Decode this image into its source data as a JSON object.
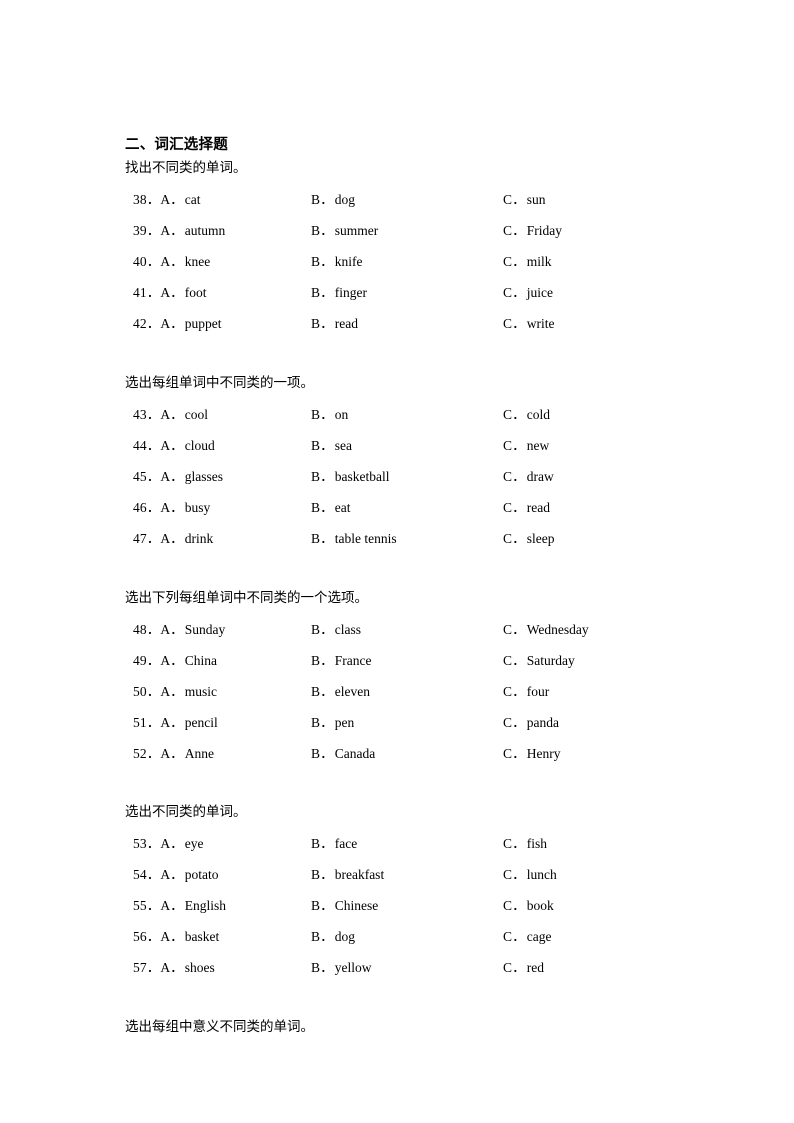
{
  "document": {
    "heading": "二、词汇选择题",
    "sections": [
      {
        "instruction": "找出不同类的单词。",
        "questions": [
          {
            "number": "38．",
            "a_label": "A．",
            "a": "cat",
            "b_label": "B．",
            "b": "dog",
            "c_label": "C．",
            "c": "sun"
          },
          {
            "number": "39．",
            "a_label": "A．",
            "a": "autumn",
            "b_label": "B．",
            "b": "summer",
            "c_label": "C．",
            "c": "Friday"
          },
          {
            "number": "40．",
            "a_label": "A．",
            "a": "knee",
            "b_label": "B．",
            "b": "knife",
            "c_label": "C．",
            "c": "milk"
          },
          {
            "number": "41．",
            "a_label": "A．",
            "a": "foot",
            "b_label": "B．",
            "b": "finger",
            "c_label": "C．",
            "c": "juice"
          },
          {
            "number": "42．",
            "a_label": "A．",
            "a": "puppet",
            "b_label": "B．",
            "b": "read",
            "c_label": "C．",
            "c": "write"
          }
        ]
      },
      {
        "instruction": "选出每组单词中不同类的一项。",
        "questions": [
          {
            "number": "43．",
            "a_label": "A．",
            "a": "cool",
            "b_label": "B．",
            "b": "on",
            "c_label": "C．",
            "c": "cold"
          },
          {
            "number": "44．",
            "a_label": "A．",
            "a": "cloud",
            "b_label": "B．",
            "b": "sea",
            "c_label": "C．",
            "c": "new"
          },
          {
            "number": "45．",
            "a_label": "A．",
            "a": "glasses",
            "b_label": "B．",
            "b": "basketball",
            "c_label": "C．",
            "c": "draw"
          },
          {
            "number": "46．",
            "a_label": "A．",
            "a": "busy",
            "b_label": "B．",
            "b": "eat",
            "c_label": "C．",
            "c": "read"
          },
          {
            "number": "47．",
            "a_label": "A．",
            "a": "drink",
            "b_label": "B．",
            "b": "table tennis",
            "c_label": "C．",
            "c": "sleep"
          }
        ]
      },
      {
        "instruction": "选出下列每组单词中不同类的一个选项。",
        "questions": [
          {
            "number": "48．",
            "a_label": "A．",
            "a": "Sunday",
            "b_label": "B．",
            "b": "class",
            "c_label": "C．",
            "c": "Wednesday"
          },
          {
            "number": "49．",
            "a_label": "A．",
            "a": "China",
            "b_label": "B．",
            "b": "France",
            "c_label": "C．",
            "c": "Saturday"
          },
          {
            "number": "50．",
            "a_label": "A．",
            "a": "music",
            "b_label": "B．",
            "b": "eleven",
            "c_label": "C．",
            "c": "four"
          },
          {
            "number": "51．",
            "a_label": "A．",
            "a": "pencil",
            "b_label": "B．",
            "b": "pen",
            "c_label": "C．",
            "c": "panda"
          },
          {
            "number": "52．",
            "a_label": "A．",
            "a": "Anne",
            "b_label": "B．",
            "b": "Canada",
            "c_label": "C．",
            "c": "Henry"
          }
        ]
      },
      {
        "instruction": "选出不同类的单词。",
        "questions": [
          {
            "number": "53．",
            "a_label": "A．",
            "a": "eye",
            "b_label": "B．",
            "b": "face",
            "c_label": "C．",
            "c": "fish"
          },
          {
            "number": "54．",
            "a_label": "A．",
            "a": "potato",
            "b_label": "B．",
            "b": "breakfast",
            "c_label": "C．",
            "c": "lunch"
          },
          {
            "number": "55．",
            "a_label": "A．",
            "a": "English",
            "b_label": "B．",
            "b": "Chinese",
            "c_label": "C．",
            "c": "book"
          },
          {
            "number": "56．",
            "a_label": "A．",
            "a": "basket",
            "b_label": "B．",
            "b": "dog",
            "c_label": "C．",
            "c": "cage"
          },
          {
            "number": "57．",
            "a_label": "A．",
            "a": "shoes",
            "b_label": "B．",
            "b": "yellow",
            "c_label": "C．",
            "c": "red"
          }
        ]
      }
    ],
    "trailing_instruction": "选出每组中意义不同类的单词。"
  }
}
